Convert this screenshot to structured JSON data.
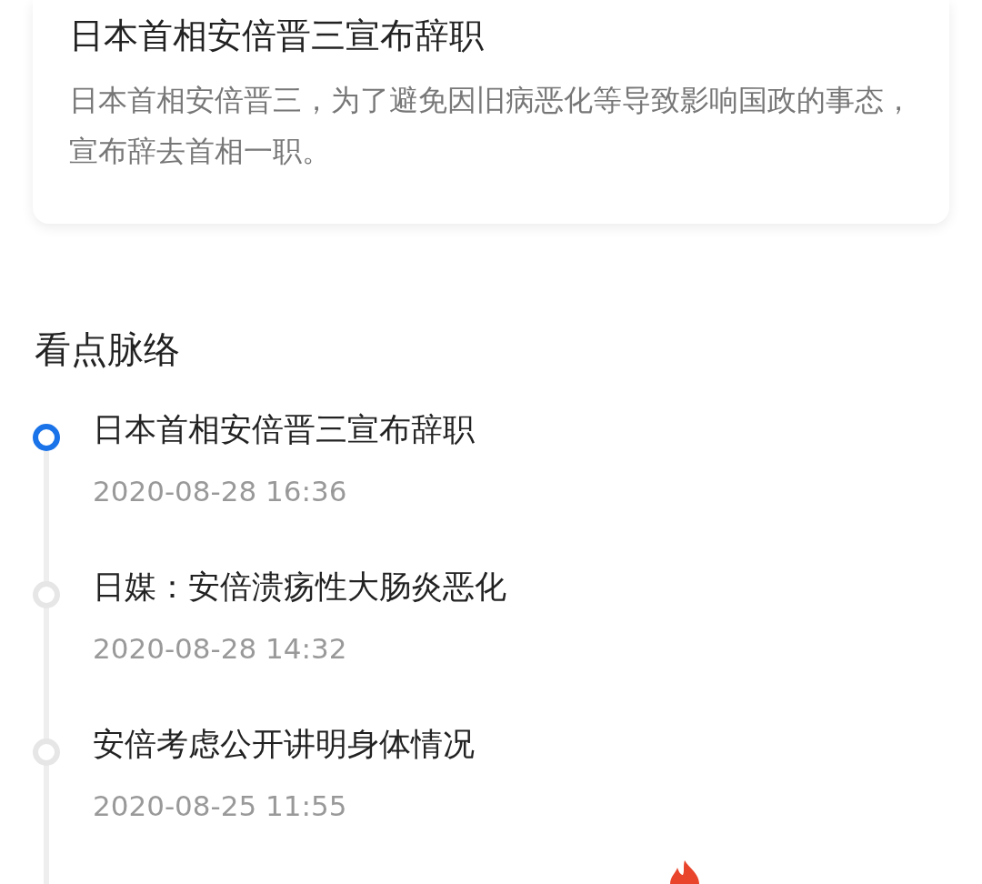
{
  "card": {
    "title": "日本首相安倍晋三宣布辞职",
    "description": "日本首相安倍晋三，为了避免因旧病恶化等导致影响国政的事态，宣布辞去首相一职。"
  },
  "section_title": "看点脉络",
  "timeline": [
    {
      "title": "日本首相安倍晋三宣布辞职",
      "time": "2020-08-28 16:36",
      "selected": true
    },
    {
      "title": "日媒：安倍溃疡性大肠炎恶化",
      "time": "2020-08-28 14:32",
      "selected": false
    },
    {
      "title": "安倍考虑公开讲明身体情况",
      "time": "2020-08-25 11:55",
      "selected": false
    }
  ]
}
